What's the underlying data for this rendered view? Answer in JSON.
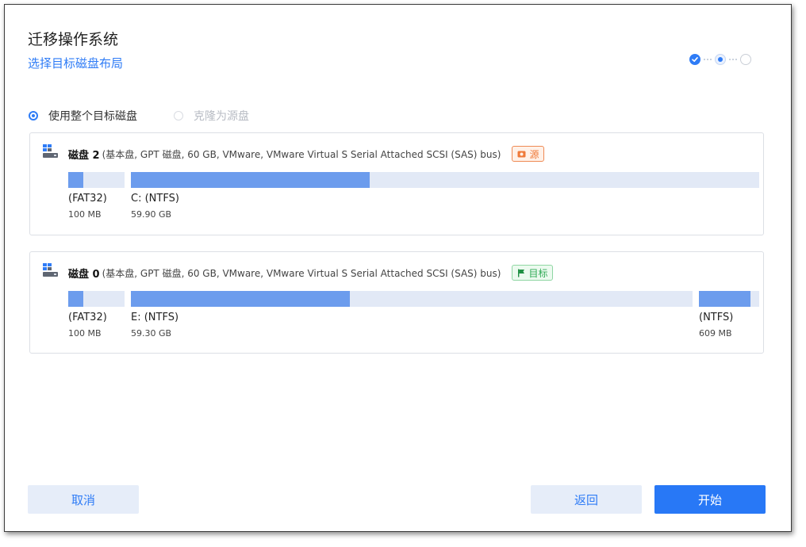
{
  "header": {
    "title": "迁移操作系统",
    "subtitle": "选择目标磁盘布局"
  },
  "steps": [
    "done",
    "current",
    "pending"
  ],
  "options": [
    {
      "label": "使用整个目标磁盘",
      "checked": true,
      "enabled": true
    },
    {
      "label": "克隆为源盘",
      "checked": false,
      "enabled": false
    }
  ],
  "disks": [
    {
      "name": "磁盘 2",
      "info": "(基本盘, GPT 磁盘, 60 GB, VMware,  VMware Virtual S Serial Attached SCSI (SAS) bus)",
      "badge": "源",
      "partitions": [
        {
          "label": "(FAT32)",
          "size": "100 MB",
          "used_fraction": 0.27
        },
        {
          "label": "C: (NTFS)",
          "size": "59.90 GB",
          "used_fraction": 0.38
        }
      ]
    },
    {
      "name": "磁盘 0",
      "info": "(基本盘, GPT 磁盘, 60 GB, VMware,  VMware Virtual S Serial Attached SCSI (SAS) bus)",
      "badge": "目标",
      "partitions": [
        {
          "label": "(FAT32)",
          "size": "100 MB",
          "used_fraction": 0.27
        },
        {
          "label": "E: (NTFS)",
          "size": "59.30 GB",
          "used_fraction": 0.39
        },
        {
          "label": "(NTFS)",
          "size": "609 MB",
          "used_fraction": 0.85
        }
      ]
    }
  ],
  "buttons": {
    "cancel": "取消",
    "back": "返回",
    "start": "开始"
  },
  "colors": {
    "accent": "#2f7cf6",
    "partition_fill": "#6c9ced",
    "partition_track": "#e2e9f6",
    "source_badge": "#ef7a3a",
    "target_badge": "#2faa55"
  },
  "icons": {
    "disk": "hard-disk-icon",
    "source": "source-disk-icon",
    "target": "target-flag-icon",
    "step_done": "check-icon"
  }
}
